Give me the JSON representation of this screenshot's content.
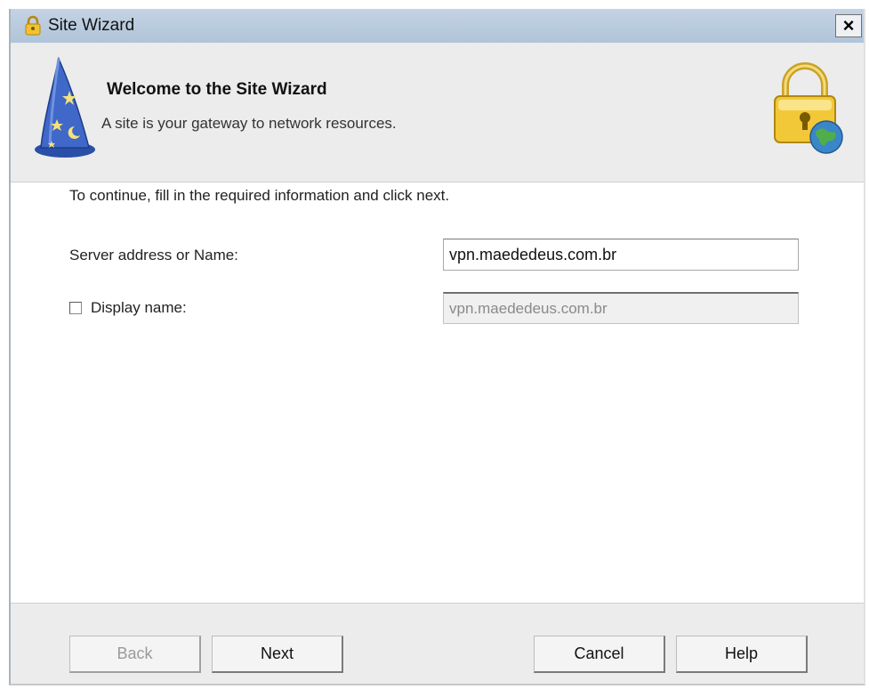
{
  "window": {
    "title": "Site Wizard",
    "close_label": "×"
  },
  "header": {
    "title": "Welcome to the Site Wizard",
    "subtitle": "A site is your gateway to network resources."
  },
  "form": {
    "instruction": "To continue, fill in the required information and click next.",
    "server_label": "Server address or Name:",
    "server_value": "vpn.maededeus.com.br",
    "display_label": "Display name:",
    "display_checked": false,
    "display_value": "vpn.maededeus.com.br"
  },
  "buttons": {
    "back": "Back",
    "next": "Next",
    "cancel": "Cancel",
    "help": "Help"
  },
  "icons": {
    "title": "lock-icon",
    "wizard": "wizard-hat-icon",
    "lock_globe": "lock-globe-icon"
  },
  "colors": {
    "titlebar": "#b0c4d9",
    "header_bg": "#ececec",
    "footer_bg": "#ececec"
  }
}
